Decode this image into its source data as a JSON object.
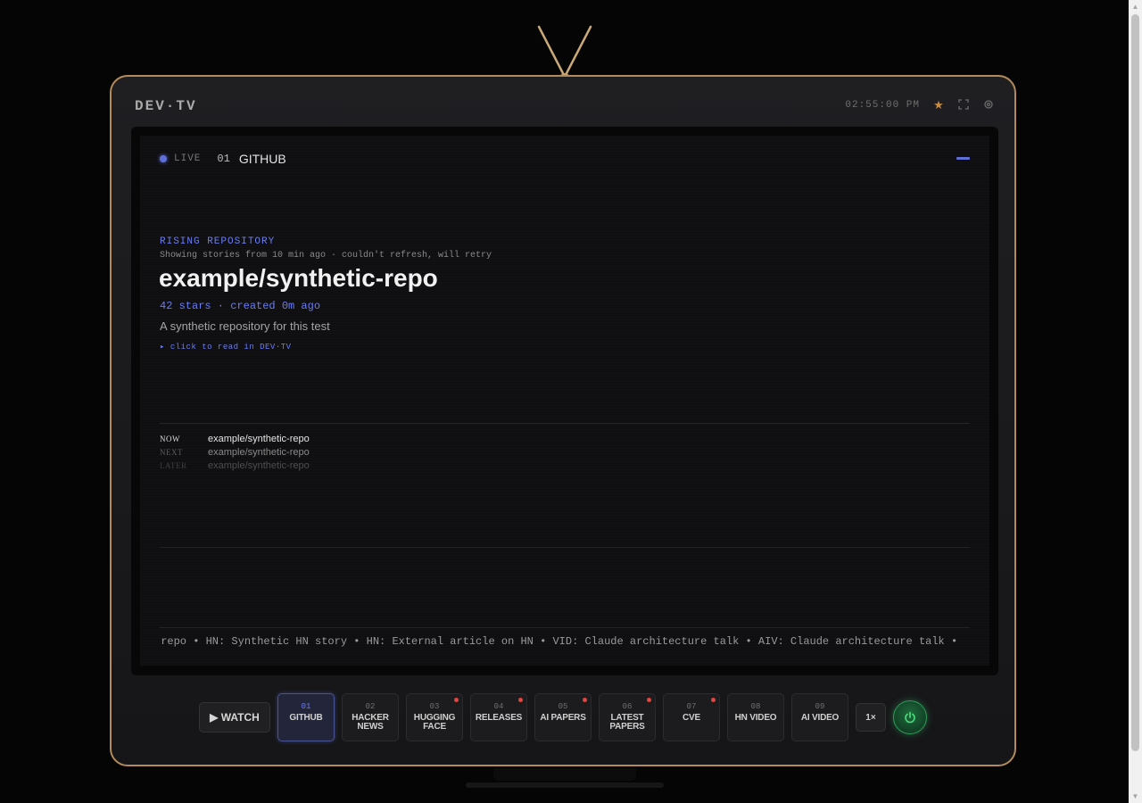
{
  "brand": "DEV·TV",
  "clock": "02:55:00 PM",
  "icons": {
    "favorite": "star-icon",
    "fullscreen": "fullscreen-icon",
    "settings": "settings-icon",
    "power": "power-icon"
  },
  "colors": {
    "accent": "#6b7cf0",
    "frame": "#b38b5a",
    "notification": "#e14646",
    "power": "#2f9d5a"
  },
  "live": {
    "label": "LIVE",
    "channel_number": "01",
    "channel_name": "GITHUB"
  },
  "story": {
    "kicker": "RISING REPOSITORY",
    "status": "Showing stories from 10 min ago · couldn't refresh, will retry",
    "title": "example/synthetic-repo",
    "meta": "42 stars · created 0m ago",
    "description": "A synthetic repository for this test",
    "read_link": "▸ click to read in DEV·TV"
  },
  "schedule": [
    {
      "label": "NOW",
      "title": "example/synthetic-repo"
    },
    {
      "label": "NEXT",
      "title": "example/synthetic-repo"
    },
    {
      "label": "LATER",
      "title": "example/synthetic-repo"
    }
  ],
  "ticker": "-repo • HN: Synthetic HN story • HN: External article on HN • VID: Claude architecture talk • AIV: Claude architecture talk •",
  "controls": {
    "watch": "▶ WATCH",
    "speed": "1×",
    "channels": [
      {
        "num": "01",
        "line1": "GITHUB",
        "line2": ""
      },
      {
        "num": "02",
        "line1": "HACKER",
        "line2": "NEWS"
      },
      {
        "num": "03",
        "line1": "HUGGING",
        "line2": "FACE"
      },
      {
        "num": "04",
        "line1": "RELEASES",
        "line2": ""
      },
      {
        "num": "05",
        "line1": "AI PAPERS",
        "line2": ""
      },
      {
        "num": "06",
        "line1": "LATEST",
        "line2": "PAPERS"
      },
      {
        "num": "07",
        "line1": "CVE",
        "line2": ""
      },
      {
        "num": "08",
        "line1": "HN VIDEO",
        "line2": ""
      },
      {
        "num": "09",
        "line1": "AI VIDEO",
        "line2": ""
      }
    ]
  }
}
